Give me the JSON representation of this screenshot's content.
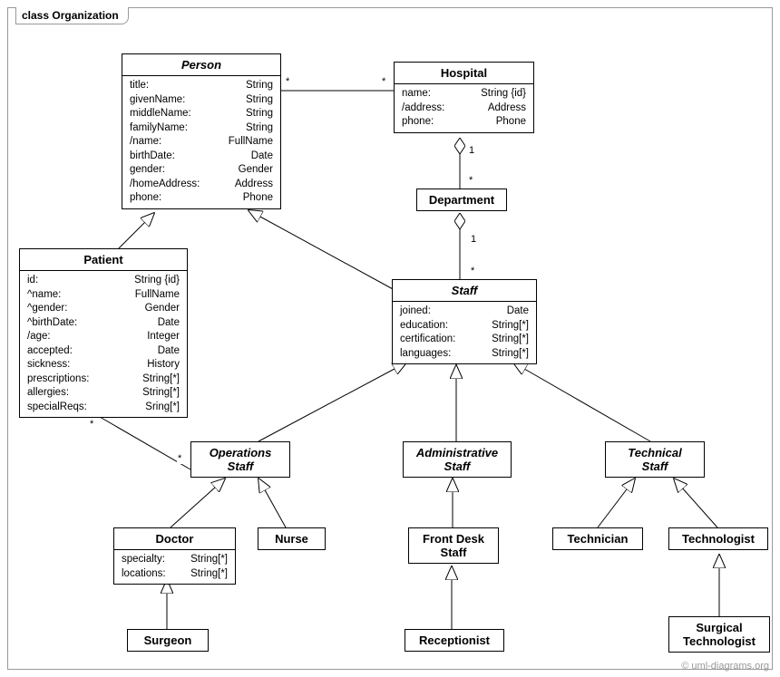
{
  "frame_title": "class Organization",
  "copyright": "© uml-diagrams.org",
  "classes": {
    "person": {
      "name": "Person",
      "attrs": [
        {
          "k": "title:",
          "v": "String"
        },
        {
          "k": "givenName:",
          "v": "String"
        },
        {
          "k": "middleName:",
          "v": "String"
        },
        {
          "k": "familyName:",
          "v": "String"
        },
        {
          "k": "/name:",
          "v": "FullName"
        },
        {
          "k": "birthDate:",
          "v": "Date"
        },
        {
          "k": "gender:",
          "v": "Gender"
        },
        {
          "k": "/homeAddress:",
          "v": "Address"
        },
        {
          "k": "phone:",
          "v": "Phone"
        }
      ]
    },
    "hospital": {
      "name": "Hospital",
      "attrs": [
        {
          "k": "name:",
          "v": "String {id}"
        },
        {
          "k": "/address:",
          "v": "Address"
        },
        {
          "k": "phone:",
          "v": "Phone"
        }
      ]
    },
    "department": {
      "name": "Department"
    },
    "patient": {
      "name": "Patient",
      "attrs": [
        {
          "k": "id:",
          "v": "String {id}"
        },
        {
          "k": "^name:",
          "v": "FullName"
        },
        {
          "k": "^gender:",
          "v": "Gender"
        },
        {
          "k": "^birthDate:",
          "v": "Date"
        },
        {
          "k": "/age:",
          "v": "Integer"
        },
        {
          "k": "accepted:",
          "v": "Date"
        },
        {
          "k": "sickness:",
          "v": "History"
        },
        {
          "k": "prescriptions:",
          "v": "String[*]"
        },
        {
          "k": "allergies:",
          "v": "String[*]"
        },
        {
          "k": "specialReqs:",
          "v": "Sring[*]"
        }
      ]
    },
    "staff": {
      "name": "Staff",
      "attrs": [
        {
          "k": "joined:",
          "v": "Date"
        },
        {
          "k": "education:",
          "v": "String[*]"
        },
        {
          "k": "certification:",
          "v": "String[*]"
        },
        {
          "k": "languages:",
          "v": "String[*]"
        }
      ]
    },
    "opstaff": {
      "name": "Operations\nStaff"
    },
    "adminstaff": {
      "name": "Administrative\nStaff"
    },
    "techstaff": {
      "name": "Technical\nStaff"
    },
    "doctor": {
      "name": "Doctor",
      "attrs": [
        {
          "k": "specialty:",
          "v": "String[*]"
        },
        {
          "k": "locations:",
          "v": "String[*]"
        }
      ]
    },
    "nurse": {
      "name": "Nurse"
    },
    "frontdesk": {
      "name": "Front Desk\nStaff"
    },
    "technician": {
      "name": "Technician"
    },
    "technologist": {
      "name": "Technologist"
    },
    "surgeon": {
      "name": "Surgeon"
    },
    "receptionist": {
      "name": "Receptionist"
    },
    "surgtech": {
      "name": "Surgical\nTechnologist"
    }
  },
  "mults": {
    "ph1": "*",
    "ph2": "*",
    "hd1": "1",
    "hd2": "*",
    "ds1": "1",
    "ds2": "*",
    "po1": "*",
    "po2": "*"
  }
}
